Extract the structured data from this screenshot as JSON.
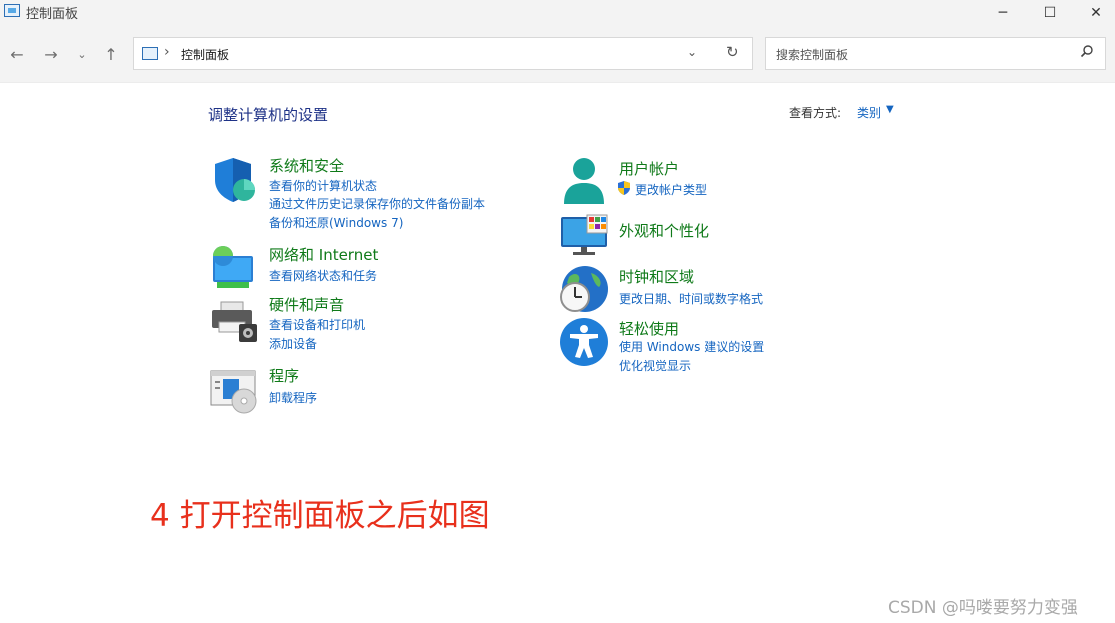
{
  "window": {
    "title": "控制面板"
  },
  "address": {
    "breadcrumb": "控制面板"
  },
  "search": {
    "placeholder": "搜索控制面板"
  },
  "main": {
    "heading": "调整计算机的设置",
    "view_by_label": "查看方式:",
    "view_by_value": "类别"
  },
  "categories": [
    {
      "title": "系统和安全",
      "links": [
        "查看你的计算机状态",
        "通过文件历史记录保存你的文件备份副本",
        "备份和还原(Windows 7)"
      ],
      "icon": "shield-icon"
    },
    {
      "title": "网络和 Internet",
      "links": [
        "查看网络状态和任务"
      ],
      "icon": "network-globe-icon"
    },
    {
      "title": "硬件和声音",
      "links": [
        "查看设备和打印机",
        "添加设备"
      ],
      "icon": "printer-icon"
    },
    {
      "title": "程序",
      "links": [
        "卸载程序"
      ],
      "icon": "programs-icon"
    },
    {
      "title": "用户帐户",
      "links": [
        "更改帐户类型"
      ],
      "icon": "user-account-icon"
    },
    {
      "title": "外观和个性化",
      "links": [],
      "icon": "monitor-icon"
    },
    {
      "title": "时钟和区域",
      "links": [
        "更改日期、时间或数字格式"
      ],
      "icon": "clock-globe-icon"
    },
    {
      "title": "轻松使用",
      "links": [
        "使用 Windows 建议的设置",
        "优化视觉显示"
      ],
      "icon": "accessibility-icon"
    }
  ],
  "annotation": "4  打开控制面板之后如图",
  "watermark": "CSDN @吗喽要努力变强"
}
